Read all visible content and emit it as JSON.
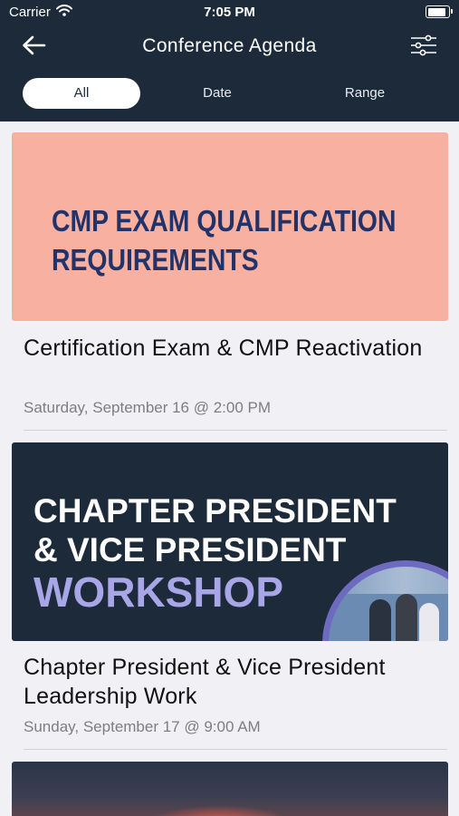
{
  "status_bar": {
    "carrier": "Carrier",
    "time": "7:05 PM",
    "battery_level": 1.0
  },
  "header": {
    "title": "Conference Agenda",
    "back_icon": "back-arrow-icon",
    "filter_icon": "sliders-icon"
  },
  "tabs": [
    {
      "label": "All",
      "active": true
    },
    {
      "label": "Date",
      "active": false
    },
    {
      "label": "Range",
      "active": false
    }
  ],
  "events": [
    {
      "banner_lines": [
        "CMP EXAM QUALIFICATION",
        "REQUIREMENTS"
      ],
      "title": "Certification Exam & CMP Reactivation",
      "date": "Saturday, September 16 @ 2:00 PM"
    },
    {
      "banner_lines": [
        "CHAPTER PRESIDENT",
        "& VICE PRESIDENT",
        "WORKSHOP"
      ],
      "title": "Chapter President & Vice President Leadership Work",
      "date": "Sunday, September 17 @ 9:00 AM"
    },
    {
      "banner_lines": [],
      "title": "",
      "date": ""
    }
  ],
  "colors": {
    "header_bg": "#1c2a3a",
    "list_bg": "#f1f1f5",
    "banner1_bg": "#f8b1a0",
    "banner1_text": "#22336a",
    "banner2_bg": "#1c2a3a",
    "banner2_accent": "#a9a6e7"
  }
}
